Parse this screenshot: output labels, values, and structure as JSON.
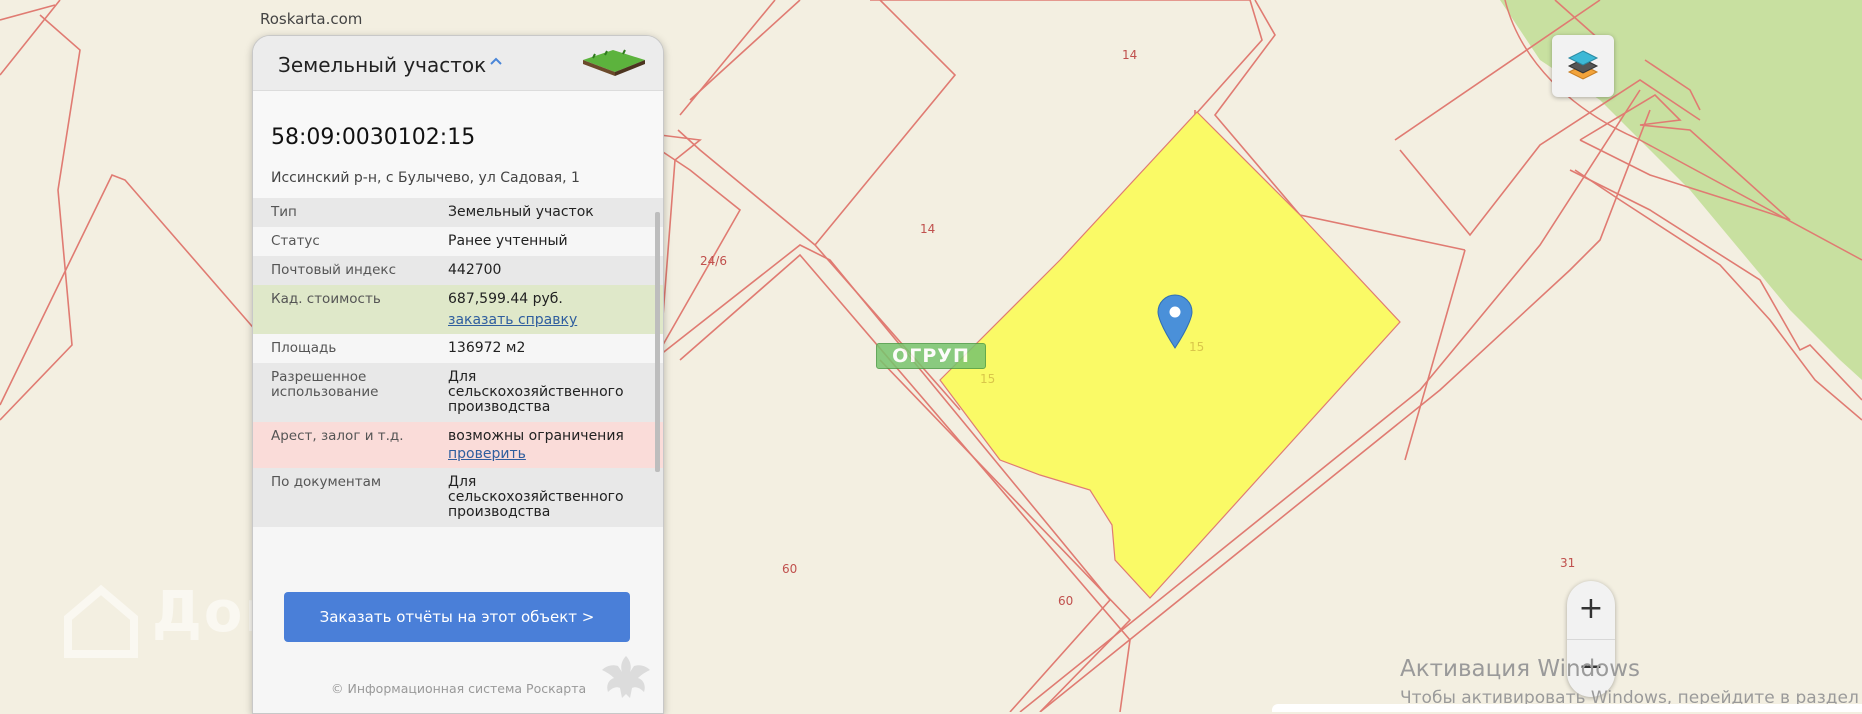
{
  "brand": "Roskarta.com",
  "panel": {
    "title": "Земельный участок",
    "caret_icon": "chevron-up-icon",
    "cadastral_number": "58:09:0030102:15",
    "address": "Иссинский р-н, с Булычево, ул Садовая, 1",
    "rows": [
      {
        "key": "Тип",
        "value": "Земельный участок"
      },
      {
        "key": "Статус",
        "value": "Ранее учтенный"
      },
      {
        "key": "Почтовый индекс",
        "value": "442700"
      },
      {
        "key": "Кад. стоимость",
        "value": "687,599.44 руб.",
        "link": "заказать справку"
      },
      {
        "key": "Площадь",
        "value": "136972 м2"
      },
      {
        "key": "Разрешенное использование",
        "value": "Для сельскохозяйственного производства"
      },
      {
        "key": "Арест, залог и т.д.",
        "value": "возможны ограничения",
        "link": "проверить"
      },
      {
        "key": "По документам",
        "value": "Для сельскохозяйственного производства"
      }
    ],
    "order_button": "Заказать отчёты на этот объект >",
    "copyright": "© Информационная система Роскарта"
  },
  "map": {
    "parcel_labels": [
      "14",
      "14",
      "24/6",
      "15",
      "15",
      "60",
      "60",
      "31"
    ],
    "overlay_badge": "ОГРУП",
    "highlight_color": "#fafa66",
    "boundary_color": "#e07b72",
    "forest_color": "#c8e0a0"
  },
  "controls": {
    "layers_icon": "layers-icon",
    "zoom_in": "+",
    "zoom_out": "−"
  },
  "watermark": "ДомКлик",
  "windows_activation": {
    "line1": "Активация Windows",
    "line2": "Чтобы активировать Windows, перейдите в раздел"
  }
}
